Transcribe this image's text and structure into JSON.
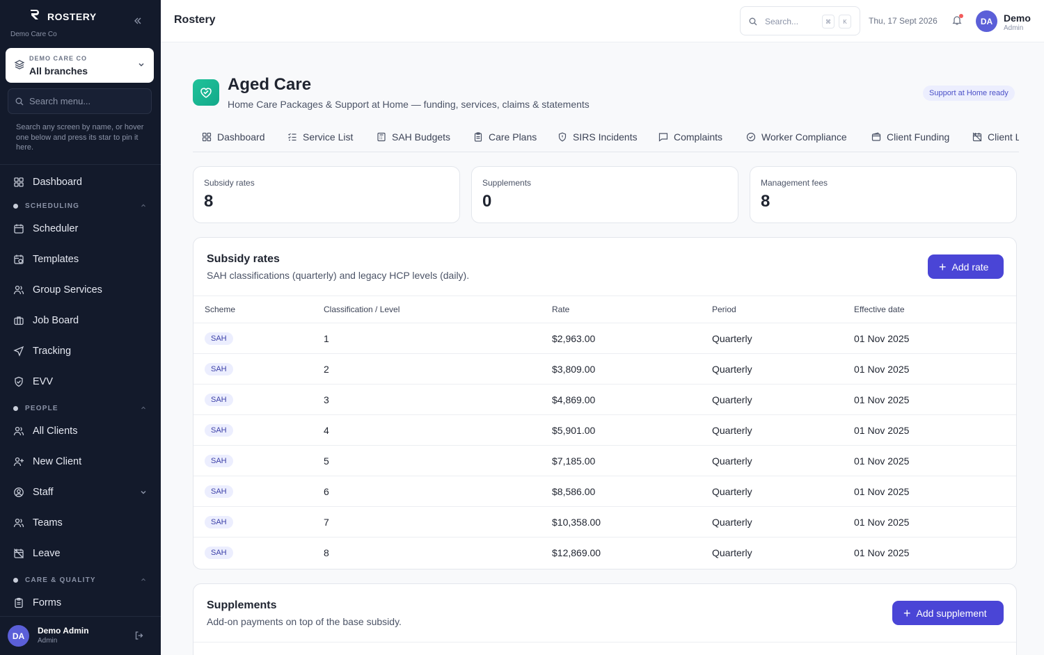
{
  "sidebar": {
    "brand": "ROSTERY",
    "org": "Demo Care Co",
    "branch_org": "DEMO CARE CO",
    "branch_name": "All branches",
    "search_placeholder": "Search menu...",
    "hint": "Search any screen by name, or hover one below and press its star to pin it here.",
    "items": {
      "dashboard": "Dashboard",
      "scheduling": "SCHEDULING",
      "scheduler": "Scheduler",
      "templates": "Templates",
      "group_services": "Group Services",
      "job_board": "Job Board",
      "tracking": "Tracking",
      "evv": "EVV",
      "people": "PEOPLE",
      "all_clients": "All Clients",
      "new_client": "New Client",
      "staff": "Staff",
      "teams": "Teams",
      "leave": "Leave",
      "care_quality": "CARE & QUALITY",
      "forms": "Forms"
    },
    "user": {
      "initials": "DA",
      "name": "Demo Admin",
      "role": "Admin"
    }
  },
  "topbar": {
    "title": "Rostery",
    "search_placeholder": "Search...",
    "kbd1": "⌘",
    "kbd2": "K",
    "date": "Thu, 17 Sept 2026",
    "user_initials": "DA",
    "user_name": "Demo",
    "user_role": "Admin"
  },
  "page": {
    "title": "Aged Care",
    "subtitle": "Home Care Packages & Support at Home — funding, services, claims & statements",
    "badge": "Support at Home ready",
    "tabs": [
      "Dashboard",
      "Service List",
      "SAH Budgets",
      "Care Plans",
      "SIRS Incidents",
      "Complaints",
      "Worker Compliance",
      "Client Funding",
      "Client L"
    ]
  },
  "stats": [
    {
      "label": "Subsidy rates",
      "value": "8"
    },
    {
      "label": "Supplements",
      "value": "0"
    },
    {
      "label": "Management fees",
      "value": "8"
    }
  ],
  "subsidy": {
    "title": "Subsidy rates",
    "subtitle": "SAH classifications (quarterly) and legacy HCP levels (daily).",
    "button": "Add rate",
    "headers": [
      "Scheme",
      "Classification / Level",
      "Rate",
      "Period",
      "Effective date"
    ],
    "rows": [
      {
        "scheme": "SAH",
        "level": "1",
        "rate": "$2,963.00",
        "period": "Quarterly",
        "date": "01 Nov 2025"
      },
      {
        "scheme": "SAH",
        "level": "2",
        "rate": "$3,809.00",
        "period": "Quarterly",
        "date": "01 Nov 2025"
      },
      {
        "scheme": "SAH",
        "level": "3",
        "rate": "$4,869.00",
        "period": "Quarterly",
        "date": "01 Nov 2025"
      },
      {
        "scheme": "SAH",
        "level": "4",
        "rate": "$5,901.00",
        "period": "Quarterly",
        "date": "01 Nov 2025"
      },
      {
        "scheme": "SAH",
        "level": "5",
        "rate": "$7,185.00",
        "period": "Quarterly",
        "date": "01 Nov 2025"
      },
      {
        "scheme": "SAH",
        "level": "6",
        "rate": "$8,586.00",
        "period": "Quarterly",
        "date": "01 Nov 2025"
      },
      {
        "scheme": "SAH",
        "level": "7",
        "rate": "$10,358.00",
        "period": "Quarterly",
        "date": "01 Nov 2025"
      },
      {
        "scheme": "SAH",
        "level": "8",
        "rate": "$12,869.00",
        "period": "Quarterly",
        "date": "01 Nov 2025"
      }
    ]
  },
  "supplements": {
    "title": "Supplements",
    "subtitle": "Add-on payments on top of the base subsidy.",
    "button": "Add supplement"
  }
}
